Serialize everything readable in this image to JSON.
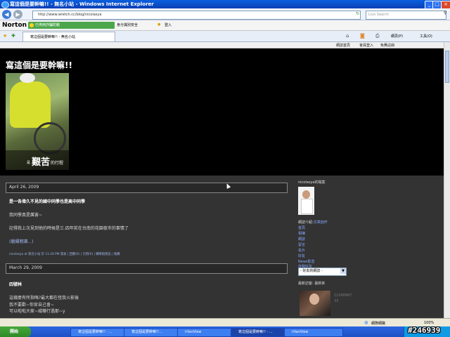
{
  "window": {
    "title": "寫這個是要幹嘛!! - 無名小站 - Windows Internet Explorer"
  },
  "toolbar": {
    "url": "http://www.wretch.cc/blog/nicolasya",
    "search_placeholder": "Live Search"
  },
  "norton": {
    "logo": "Norton",
    "status": "已停用詐騙防範",
    "identity": "身分識別安全",
    "login": "登入"
  },
  "tab": {
    "label": "寫這個是要幹嘛!! - 無名小站"
  },
  "cmdbar": {
    "page": "網頁(P)",
    "tools": "工具(O)"
  },
  "blognav": {
    "home": "網誌首頁",
    "login": "會員登入",
    "register": "免費註冊"
  },
  "blog": {
    "title": "寫這個是要幹嘛!!",
    "header_caption": {
      "pre": "是",
      "big": "艱苦",
      "post": "的行程"
    }
  },
  "posts": [
    {
      "date": "April 26, 2009",
      "title": "是一各偉久不見的國中同學也是高中同學",
      "lines": [
        "我同學真是厲害~",
        "記得我上次見到他的時候是三.四年前在台南的花園夜市的事情了"
      ],
      "more": "(繼續閱讀...)",
      "footer": "nicolasya at 無名小站 於 11:24 PM 發表 | 回應(0) | 引用(0) | 轉寄給朋友 | 推薦"
    },
    {
      "date": "March 29, 2009",
      "title": "四號林",
      "lines": [
        "這幾麼有所指嗎?最大都在怪我火影後",
        "我不要歡~你官自己會~",
        "可以啦啦大家~威嚇行過那~y"
      ]
    }
  ],
  "sidebar": {
    "profile_title": "nicolasya的檔案",
    "intro_label": "網誌介紹:",
    "intro_link": "文章創作",
    "links": [
      "首頁",
      "相簿",
      "網誌",
      "留言",
      "名片",
      "好友",
      "News影音",
      "找我好友"
    ],
    "friend_select": "- 好友的網誌 -",
    "last_visitors_title": "最新訪客: 最新來",
    "visitor_code": "11098967",
    "visitor_code2": "33"
  },
  "statusbar": {
    "zone": "網際網路",
    "zoom": "100%"
  },
  "taskbar": {
    "start": "開始",
    "items": [
      "寫這個是要幹嘛!! - ...",
      "寫這個是要幹嘛!!...",
      "IrfanView",
      "寫這個是要幹嘛!! - ...",
      "IrfanView"
    ],
    "active_index": 3
  },
  "watermark": "#246939"
}
